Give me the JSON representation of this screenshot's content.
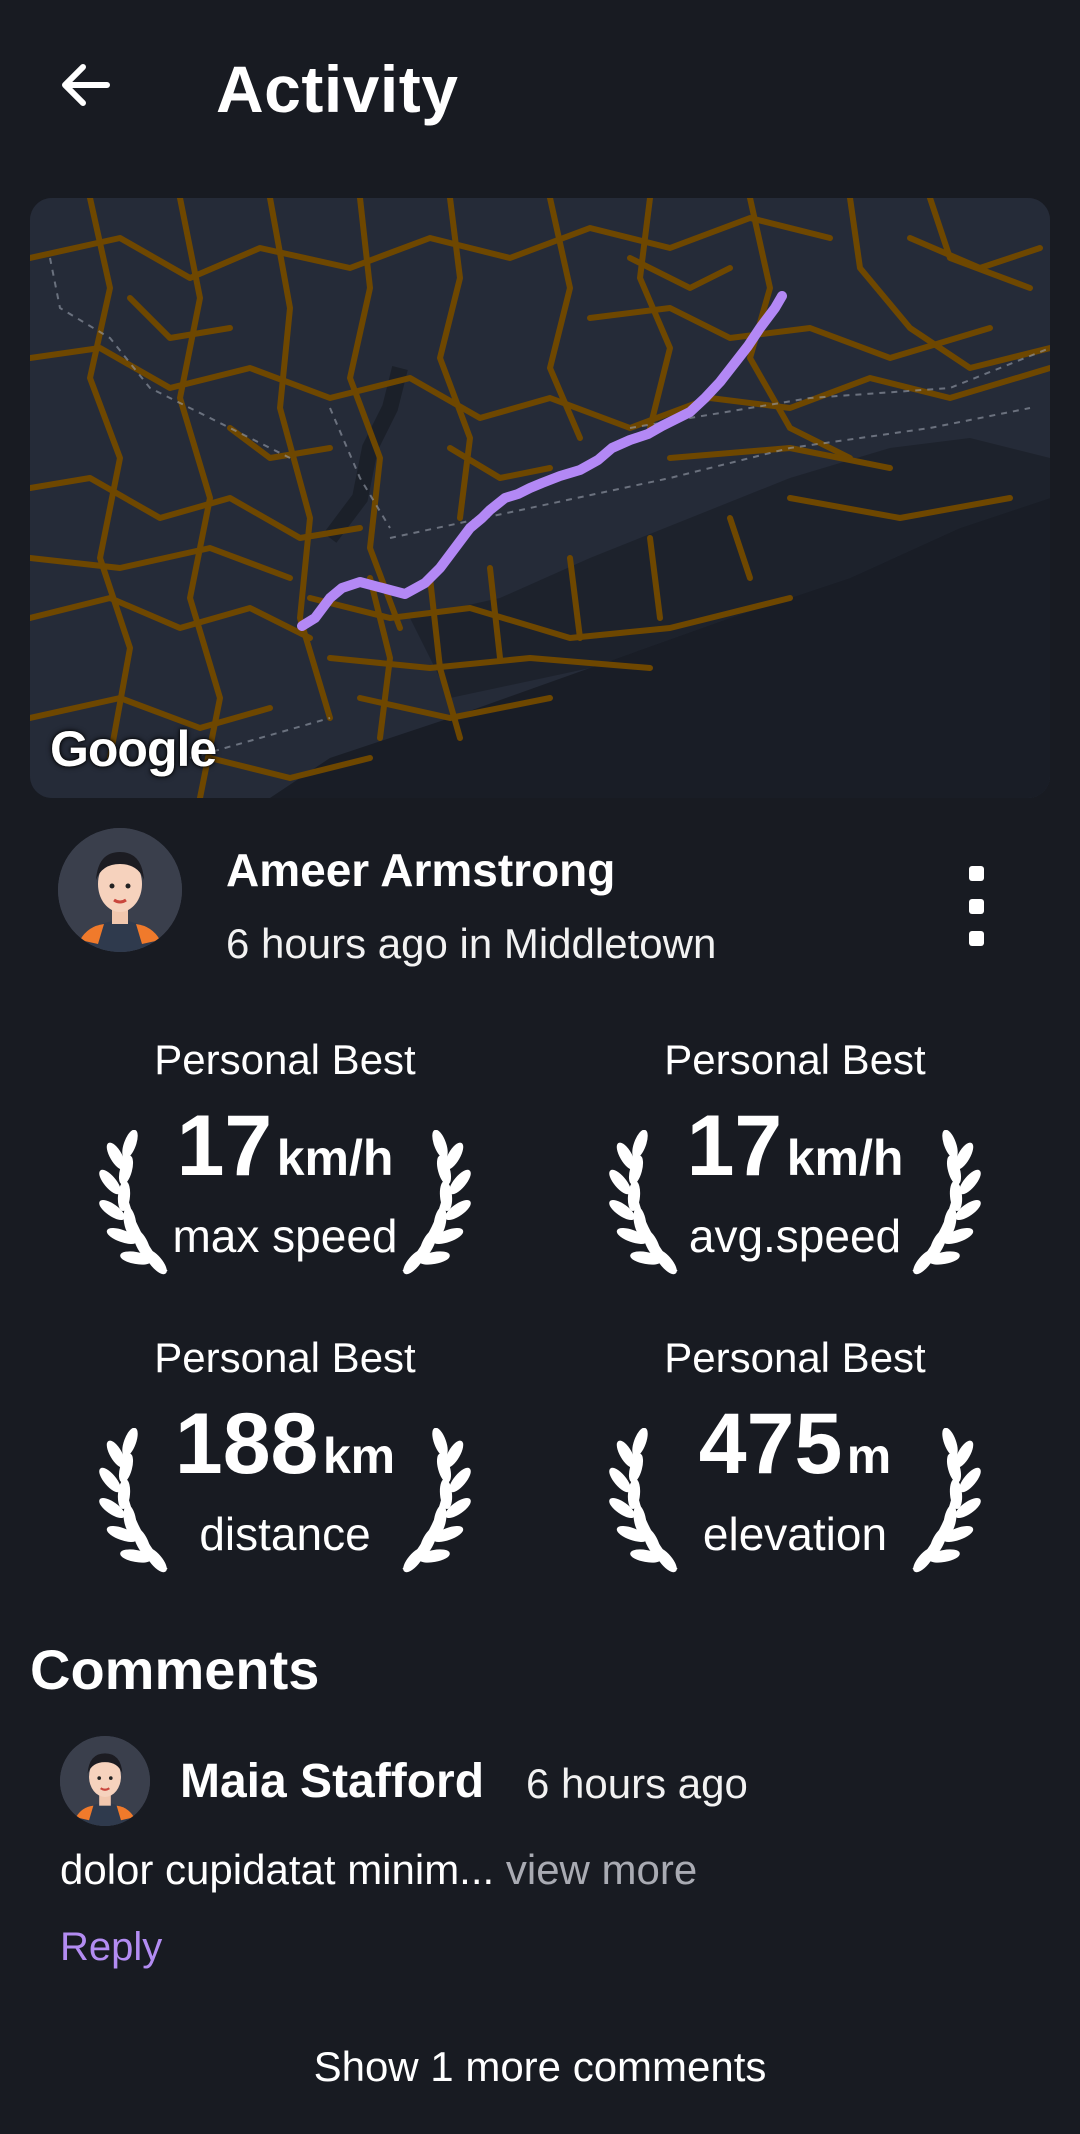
{
  "header": {
    "title": "Activity",
    "back_icon": "arrow-left-icon"
  },
  "map": {
    "attribution": "Google",
    "route_color": "#b388f5",
    "road_color": "#7a4f00"
  },
  "author": {
    "name": "Ameer Armstrong",
    "meta": "6 hours ago in Middletown",
    "menu_icon": "more-vertical-icon"
  },
  "badges": [
    {
      "title": "Personal Best",
      "value": "17",
      "unit": "km/h",
      "label": "max speed"
    },
    {
      "title": "Personal Best",
      "value": "17",
      "unit": "km/h",
      "label": "avg.speed"
    },
    {
      "title": "Personal Best",
      "value": "188",
      "unit": "km",
      "label": "distance"
    },
    {
      "title": "Personal Best",
      "value": "475",
      "unit": "m",
      "label": "elevation"
    }
  ],
  "comments": {
    "title": "Comments",
    "items": [
      {
        "name": "Maia Stafford",
        "time": "6 hours ago",
        "text": "dolor cupidatat minim...",
        "more": " view more",
        "reply": "Reply"
      }
    ],
    "show_more": "Show 1 more comments"
  },
  "colors": {
    "background": "#181b22",
    "accent": "#b38cf2"
  }
}
